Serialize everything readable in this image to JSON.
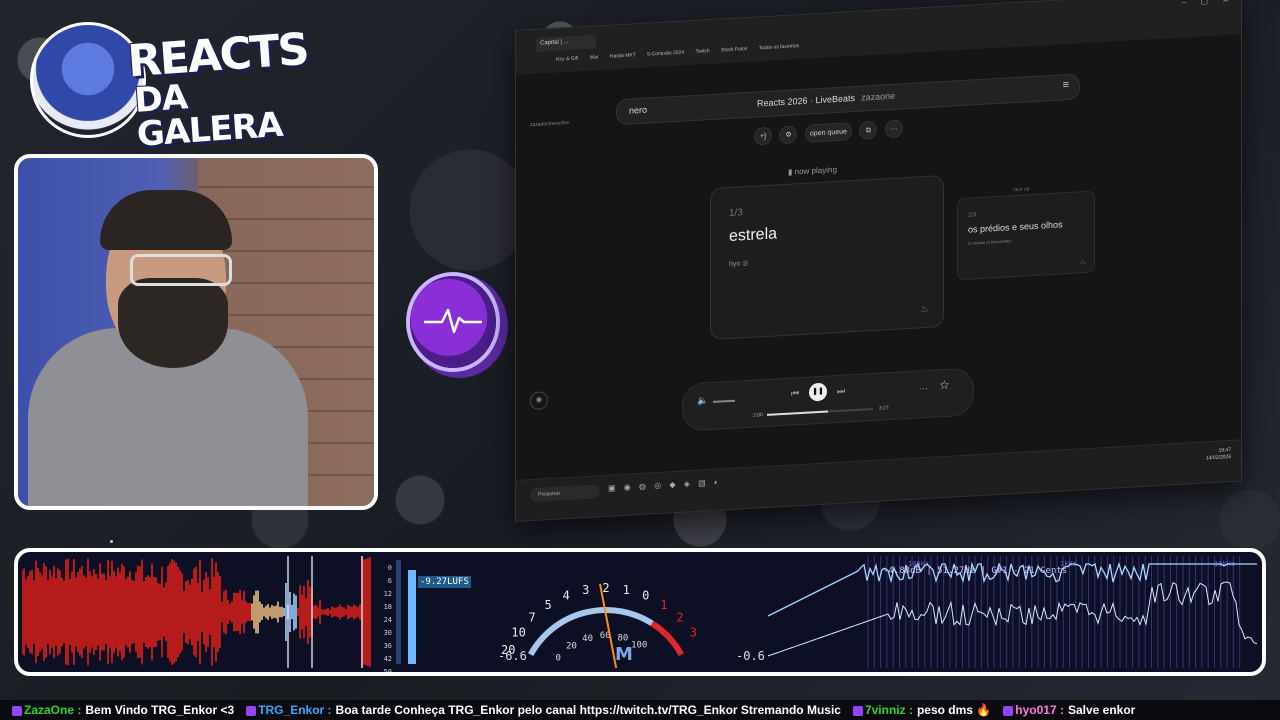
{
  "overlay": {
    "logo_line1": "REACTS",
    "logo_line2": "DA GALERA"
  },
  "browser": {
    "tab_title": "Capital | ...",
    "url": "zazadon/nero/live",
    "bookmarks": [
      "Key & Gift",
      "Mar",
      "Hacks MKT",
      "5-Conexão 2024",
      "Twitch",
      "Stock Fotos",
      "Todos os favoritos"
    ],
    "window_controls": "– ▢ ✕"
  },
  "app": {
    "brand": "nero",
    "title": "Reacts 2026 · LiveBeats",
    "owner": "zazaone",
    "menu_icon": "≡",
    "controls": {
      "add": "+]",
      "settings": "⚙",
      "open_queue": "open queue",
      "share": "⧉",
      "more": "···"
    },
    "now_playing_label": "now playing",
    "current": {
      "position": "1/3",
      "song": "estrela",
      "artist": "hyo"
    },
    "next_up_label": "next up",
    "next": {
      "position": "2/3",
      "song": "os prédios e seus olhos",
      "meta": "3 colunas  ◫ bloco/vídeo"
    },
    "player": {
      "elapsed": "2:00",
      "duration": "3:27",
      "progress_fraction": 0.58
    }
  },
  "taskbar": {
    "search_placeholder": "Pesquisar",
    "time": "19:47",
    "date": "14/02/2026"
  },
  "audio_panel": {
    "lufs_ticks": [
      "0",
      "6",
      "12",
      "18",
      "24",
      "30",
      "36",
      "42",
      "50"
    ],
    "lufs_value": "-9.27LUFS",
    "vu_scale_outer": [
      "20",
      "10",
      "7",
      "5",
      "4",
      "3",
      "2",
      "1",
      "0",
      "1",
      "2",
      "3"
    ],
    "vu_scale_inner": [
      "0",
      "20",
      "40",
      "60",
      "80",
      "100"
    ],
    "vu_left": "-6.6",
    "vu_right": "-0.6",
    "vu_label": "M",
    "spectrum_info": "-4.88dB | 51.27Hz | G#1 - 21 Cents",
    "spectrum_markers": [
      "100Hz",
      "1kHz",
      "10kHz"
    ],
    "colors": {
      "wave_red": "#e2201c",
      "vu_red": "#e1262c",
      "spectrum": "#a7d8ff",
      "lufs": "#6fb7ff"
    }
  },
  "chat": [
    {
      "user": "ZazaOne",
      "color": "#2dd62d",
      "text": "Bem Vindo TRG_Enkor <3"
    },
    {
      "user": "TRG_Enkor",
      "color": "#3aa7ff",
      "text": "Boa tarde  Conheça TRG_Enkor pelo canal https://twitch.tv/TRG_Enkor Stremando Music"
    },
    {
      "user": "7vinniz",
      "color": "#2dd62d",
      "text": "peso dms 🔥"
    },
    {
      "user": "hyo017",
      "color": "#ff7ad9",
      "text": "Salve enkor"
    }
  ]
}
